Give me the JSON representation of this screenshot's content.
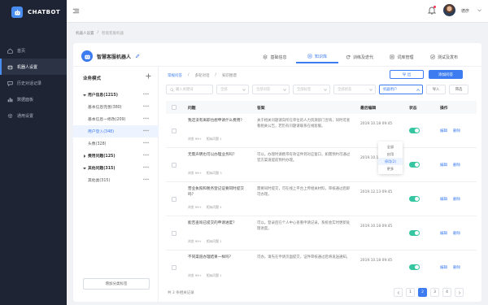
{
  "brand": {
    "name": "CHATBOT"
  },
  "sidebar": {
    "items": [
      {
        "label": "首页",
        "icon": "home-icon"
      },
      {
        "label": "机器人设置",
        "icon": "robot-icon",
        "active": true
      },
      {
        "label": "历史对话记录",
        "icon": "chat-icon"
      },
      {
        "label": "数据面板",
        "icon": "chart-icon"
      },
      {
        "label": "通用设置",
        "icon": "gear-icon"
      }
    ]
  },
  "topbar": {
    "user_name": "德彦"
  },
  "breadcrumb": [
    "机器人设置",
    "/",
    "智能客服机器"
  ],
  "bot": {
    "name": "智慧客服机器人"
  },
  "tabs": [
    {
      "label": "基础信息",
      "icon": "info-icon"
    },
    {
      "label": "知识库",
      "icon": "book-icon",
      "active": true
    },
    {
      "label": "训练及迭代",
      "icon": "refresh-icon"
    },
    {
      "label": "词库管理",
      "icon": "list-icon"
    },
    {
      "label": "测试及发布",
      "icon": "check-icon"
    }
  ],
  "tree": {
    "title": "业务模式",
    "items": [
      {
        "label": "用户信息(1215)",
        "level": 0,
        "expanded": true
      },
      {
        "label": "基本信息完善(380)",
        "level": 1
      },
      {
        "label": "基本信息—修改(209)",
        "level": 1
      },
      {
        "label": "用户登入(348)",
        "level": 1,
        "active": true
      },
      {
        "label": "头像(328)",
        "level": 1
      },
      {
        "label": "费用问题(125)",
        "level": 0,
        "expanded": false
      },
      {
        "label": "其他问题(315)",
        "level": 0,
        "expanded": true
      },
      {
        "label": "其他类(315)",
        "level": 1
      }
    ],
    "bottom_button": "增加分类标签"
  },
  "content": {
    "subtabs": [
      "常规问答",
      "/",
      "多轮对话",
      "/",
      "知识图谱"
    ],
    "btn_outline": "导 出",
    "btn_primary": "添加问答",
    "filters": {
      "search_placeholder": "输入关键词",
      "f1": "全部",
      "f2": "全部问答",
      "f3": "全部标签",
      "f4": "全部状态",
      "f5": "机器用户",
      "btn1": "导入",
      "btn2": "筛选"
    },
    "dropdown": [
      "全部",
      "启用",
      "停用(2)",
      "更多"
    ]
  },
  "table": {
    "headers": {
      "question": "问题",
      "answer": "答案",
      "time": "最后编辑",
      "status": "状态",
      "ops": "操作"
    },
    "rows": [
      {
        "question": "我还没有离职也想申请什么费用？",
        "meta1": "浏览 99+",
        "meta2": "相似问题 1",
        "answer": "关于相关问题请向所在单位的人力资源部门咨询，同时可查看相关公告，若仍有问题请联系在线客服。",
        "time": "2019.10.18 09:45",
        "edit": "编辑",
        "del": "删除"
      },
      {
        "question": "无需声明也可以办理业务吗？",
        "meta1": "浏览 99+",
        "meta2": "相似问题 3",
        "answer": "可以。办理时请携带有效证件到对应窗口，如需预约可通过官方渠道提前预约办理。",
        "time": "2019.10.18 09:45",
        "edit": "编辑",
        "del": "删除"
      },
      {
        "question": "营业执照和税务登记证要同时提交吗？",
        "meta1": "浏览 99+",
        "meta2": "相似问题 1",
        "answer": "需要同时提交，可在线上平台上传相关材料，审核通过后即可办理。",
        "time": "2019.12.13 09:45",
        "edit": "编辑",
        "del": "删除"
      },
      {
        "question": "能否查询已提交的申请进度？",
        "meta1": "浏览 99+",
        "meta2": "相似问题 1",
        "answer": "可以。登录后在个人中心查看申请记录，系统会实时更新处理进度。",
        "time": "2019.10.18 09:45",
        "edit": "编辑",
        "del": "删除"
      },
      {
        "question": "不同渠道办理结果一样吗？",
        "meta1": "浏览 99+",
        "meta2": "相似问题 1",
        "answer": "可办。请先在申请页面提交，证件审核通过后将发送通知。",
        "time": "2019.10.18 09:45",
        "edit": "编辑",
        "del": "删除"
      }
    ]
  },
  "footer": {
    "summary": "共 3 条相关记录",
    "pages": [
      "1",
      "2",
      "3",
      "4"
    ],
    "current_page": "2"
  },
  "colors": {
    "accent": "#3c7cf0",
    "sidebar": "#1e2433",
    "toggle_on": "#35c5a0"
  }
}
